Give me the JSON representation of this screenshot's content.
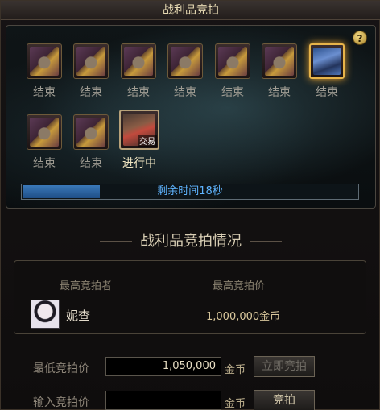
{
  "window": {
    "title": "战利品竞拍"
  },
  "help": {
    "icon": "question-mark-icon",
    "label": "?"
  },
  "items": [
    {
      "label": "结束",
      "state": "ended"
    },
    {
      "label": "结束",
      "state": "ended"
    },
    {
      "label": "结束",
      "state": "ended"
    },
    {
      "label": "结束",
      "state": "ended"
    },
    {
      "label": "结束",
      "state": "ended"
    },
    {
      "label": "结束",
      "state": "ended"
    },
    {
      "label": "结束",
      "state": "ended-selected"
    },
    {
      "label": "结束",
      "state": "ended"
    },
    {
      "label": "结束",
      "state": "ended"
    },
    {
      "label": "进行中",
      "state": "active",
      "tag": "交易"
    }
  ],
  "progress": {
    "text": "剩余时间18秒",
    "fraction": 0.23
  },
  "section": {
    "title": "战利品竞拍情况"
  },
  "bid_info": {
    "header_bidder": "最高竞拍者",
    "header_price": "最高竞拍价",
    "bidder_name": "妮查",
    "bidder_price": "1,000,000金币"
  },
  "min_bid": {
    "label": "最低竞拍价",
    "value": "1,050,000",
    "unit": "金币",
    "button": "立即竞拍"
  },
  "input_bid": {
    "label": "输入竞拍价",
    "value": "",
    "unit": "金币",
    "button": "竞拍"
  }
}
